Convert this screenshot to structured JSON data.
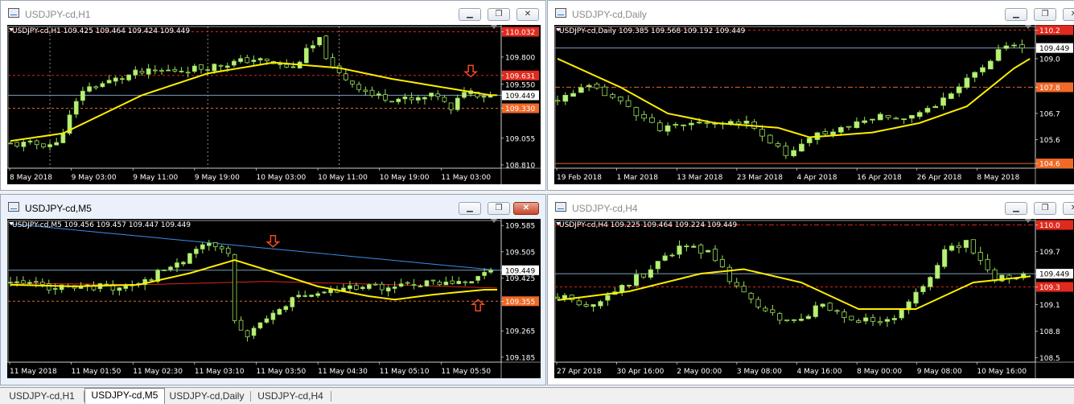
{
  "windows": [
    {
      "id": "h1",
      "title": "USDJPY-cd,H1",
      "symbol_line": "USDJPY-cd,H1  109.425 109.464 109.424 109.449",
      "active": false,
      "close_red": false,
      "chart": {
        "price_labels": [
          {
            "text": "110.032",
            "value": 110.032,
            "style": "red"
          },
          {
            "text": "109.800",
            "value": 109.8,
            "style": "plain"
          },
          {
            "text": "109.631",
            "value": 109.631,
            "style": "red"
          },
          {
            "text": "109.550",
            "value": 109.55,
            "style": "plain"
          },
          {
            "text": "109.449",
            "value": 109.449,
            "style": "white"
          },
          {
            "text": "109.330",
            "value": 109.33,
            "style": "orange"
          },
          {
            "text": "109.055",
            "value": 109.055,
            "style": "plain"
          },
          {
            "text": "108.810",
            "value": 108.81,
            "style": "plain"
          }
        ],
        "time_labels": [
          "8 May 2018",
          "9 May 03:00",
          "9 May 11:00",
          "9 May 19:00",
          "10 May 03:00",
          "10 May 11:00",
          "10 May 19:00",
          "11 May 03:00"
        ],
        "ymin": 108.78,
        "ymax": 110.08,
        "n": 74,
        "seed": 11,
        "start": 109.0,
        "end": 109.449,
        "shape": [
          [
            0,
            109.0
          ],
          [
            8,
            109.0
          ],
          [
            12,
            109.5
          ],
          [
            20,
            109.65
          ],
          [
            30,
            109.7
          ],
          [
            38,
            109.78
          ],
          [
            44,
            109.7
          ],
          [
            46,
            109.85
          ],
          [
            48,
            109.95
          ],
          [
            50,
            109.68
          ],
          [
            56,
            109.45
          ],
          [
            62,
            109.4
          ],
          [
            66,
            109.45
          ],
          [
            68,
            109.3
          ],
          [
            70,
            109.5
          ],
          [
            73,
            109.449
          ]
        ],
        "ma_shape": [
          [
            0,
            109.03
          ],
          [
            8,
            109.1
          ],
          [
            20,
            109.45
          ],
          [
            30,
            109.65
          ],
          [
            40,
            109.75
          ],
          [
            50,
            109.7
          ],
          [
            58,
            109.6
          ],
          [
            66,
            109.52
          ],
          [
            73,
            109.45
          ]
        ],
        "hlines": [
          {
            "value": 110.032,
            "color": "#d9261c",
            "dash": "3,3"
          },
          {
            "value": 109.631,
            "color": "#d9261c",
            "dash": "3,3"
          },
          {
            "value": 109.449,
            "color": "#7f9cb8",
            "dash": ""
          },
          {
            "value": 109.33,
            "color": "#e06a28",
            "dash": "3,3"
          }
        ],
        "vlines": [
          6,
          30,
          50
        ],
        "arrows": [
          {
            "kind": "down",
            "idx": 70,
            "value": 109.62
          }
        ]
      }
    },
    {
      "id": "daily",
      "title": "USDJPY-cd,Daily",
      "symbol_line": "USDJPY-cd,Daily  109.385 109.568 109.192 109.449",
      "active": false,
      "close_red": false,
      "chart": {
        "price_labels": [
          {
            "text": "110.2",
            "value": 110.2,
            "style": "red"
          },
          {
            "text": "109.449",
            "value": 109.449,
            "style": "white"
          },
          {
            "text": "109.0",
            "value": 109.0,
            "style": "plain"
          },
          {
            "text": "107.8",
            "value": 107.8,
            "style": "orange"
          },
          {
            "text": "106.7",
            "value": 106.7,
            "style": "plain"
          },
          {
            "text": "105.6",
            "value": 105.6,
            "style": "plain"
          },
          {
            "text": "104.6",
            "value": 104.6,
            "style": "orange"
          }
        ],
        "time_labels": [
          "19 Feb 2018",
          "1 Mar 2018",
          "13 Mar 2018",
          "23 Mar 2018",
          "4 Apr 2018",
          "16 Apr 2018",
          "26 Apr 2018",
          "8 May 2018"
        ],
        "ymin": 104.4,
        "ymax": 110.35,
        "n": 60,
        "seed": 23,
        "start": 107.2,
        "end": 109.449,
        "shape": [
          [
            0,
            107.2
          ],
          [
            5,
            107.8
          ],
          [
            10,
            107.0
          ],
          [
            14,
            106.0
          ],
          [
            20,
            106.4
          ],
          [
            26,
            106.2
          ],
          [
            30,
            104.9
          ],
          [
            34,
            105.8
          ],
          [
            38,
            106.2
          ],
          [
            42,
            106.6
          ],
          [
            46,
            106.6
          ],
          [
            50,
            107.3
          ],
          [
            54,
            108.4
          ],
          [
            58,
            109.6
          ],
          [
            60,
            109.449
          ]
        ],
        "ma_shape": [
          [
            0,
            109.0
          ],
          [
            8,
            107.8
          ],
          [
            14,
            106.7
          ],
          [
            20,
            106.3
          ],
          [
            28,
            106.1
          ],
          [
            32,
            105.7
          ],
          [
            40,
            105.9
          ],
          [
            46,
            106.3
          ],
          [
            52,
            107.0
          ],
          [
            58,
            108.6
          ],
          [
            60,
            109.0
          ]
        ],
        "hlines": [
          {
            "value": 110.2,
            "color": "#d9261c",
            "dash": "3,3"
          },
          {
            "value": 109.449,
            "color": "#7f9cb8",
            "dash": ""
          },
          {
            "value": 107.8,
            "color": "#e06a28",
            "dash": "6,3,2,3"
          },
          {
            "value": 104.6,
            "color": "#e06a28",
            "dash": ""
          }
        ],
        "vlines": [],
        "arrows": []
      }
    },
    {
      "id": "m5",
      "title": "USDJPY-cd,M5",
      "symbol_line": "USDJPY-cd,M5  109.456 109.457 109.447 109.449",
      "active": true,
      "close_red": true,
      "chart": {
        "price_labels": [
          {
            "text": "109.585",
            "value": 109.585,
            "style": "plain"
          },
          {
            "text": "109.505",
            "value": 109.505,
            "style": "plain"
          },
          {
            "text": "109.449",
            "value": 109.449,
            "style": "white"
          },
          {
            "text": "109.425",
            "value": 109.425,
            "style": "plain"
          },
          {
            "text": "109.355",
            "value": 109.355,
            "style": "orange"
          },
          {
            "text": "109.265",
            "value": 109.265,
            "style": "plain"
          },
          {
            "text": "109.185",
            "value": 109.185,
            "style": "plain"
          }
        ],
        "time_labels": [
          "11 May 2018",
          "11 May 01:50",
          "11 May 02:30",
          "11 May 03:10",
          "11 May 03:50",
          "11 May 04:30",
          "11 May 05:10",
          "11 May 05:50"
        ],
        "ymin": 109.17,
        "ymax": 109.6,
        "n": 76,
        "seed": 37,
        "start": 109.41,
        "end": 109.449,
        "shape": [
          [
            0,
            109.41
          ],
          [
            10,
            109.395
          ],
          [
            20,
            109.4
          ],
          [
            26,
            109.46
          ],
          [
            32,
            109.53
          ],
          [
            35,
            109.5
          ],
          [
            36,
            109.3
          ],
          [
            38,
            109.25
          ],
          [
            45,
            109.36
          ],
          [
            52,
            109.39
          ],
          [
            60,
            109.4
          ],
          [
            68,
            109.41
          ],
          [
            73,
            109.42
          ],
          [
            76,
            109.449
          ]
        ],
        "ma_shape": [
          [
            0,
            109.405
          ],
          [
            10,
            109.4
          ],
          [
            20,
            109.405
          ],
          [
            28,
            109.44
          ],
          [
            35,
            109.48
          ],
          [
            40,
            109.45
          ],
          [
            48,
            109.4
          ],
          [
            56,
            109.37
          ],
          [
            60,
            109.36
          ],
          [
            66,
            109.375
          ],
          [
            74,
            109.39
          ]
        ],
        "extra_lines": [
          {
            "color": "#3a8ee6",
            "pts": [
              [
                0,
                109.59
              ],
              [
                76,
                109.449
              ]
            ]
          },
          {
            "color": "#d9261c",
            "pts": [
              [
                0,
                109.41
              ],
              [
                20,
                109.405
              ],
              [
                40,
                109.415
              ],
              [
                60,
                109.405
              ],
              [
                76,
                109.395
              ]
            ]
          }
        ],
        "hlines": [
          {
            "value": 109.449,
            "color": "#7f9cb8",
            "dash": ""
          },
          {
            "value": 109.355,
            "color": "#e06a28",
            "dash": "3,3"
          }
        ],
        "vlines": [],
        "arrows": [
          {
            "kind": "down",
            "idx": 41,
            "value": 109.52
          },
          {
            "kind": "up",
            "idx": 73,
            "value": 109.36
          }
        ]
      }
    },
    {
      "id": "h4",
      "title": "USDJPY-cd,H4",
      "symbol_line": "USDJPY-cd,H4  109.225 109.464 109.224 109.449",
      "active": false,
      "close_red": false,
      "chart": {
        "price_labels": [
          {
            "text": "110.0",
            "value": 110.0,
            "style": "red"
          },
          {
            "text": "109.7",
            "value": 109.7,
            "style": "plain"
          },
          {
            "text": "109.449",
            "value": 109.449,
            "style": "white"
          },
          {
            "text": "109.3",
            "value": 109.3,
            "style": "red"
          },
          {
            "text": "109.1",
            "value": 109.1,
            "style": "plain"
          },
          {
            "text": "108.8",
            "value": 108.8,
            "style": "plain"
          },
          {
            "text": "108.5",
            "value": 108.5,
            "style": "plain"
          }
        ],
        "time_labels": [
          "27 Apr 2018",
          "30 Apr 16:00",
          "2 May 00:00",
          "3 May 08:00",
          "4 May 16:00",
          "8 May 00:00",
          "9 May 08:00",
          "10 May 16:00"
        ],
        "ymin": 108.45,
        "ymax": 110.05,
        "n": 66,
        "seed": 53,
        "start": 109.2,
        "end": 109.449,
        "shape": [
          [
            0,
            109.2
          ],
          [
            6,
            109.1
          ],
          [
            10,
            109.3
          ],
          [
            14,
            109.5
          ],
          [
            18,
            109.75
          ],
          [
            22,
            109.7
          ],
          [
            25,
            109.4
          ],
          [
            30,
            109.0
          ],
          [
            34,
            108.9
          ],
          [
            38,
            109.1
          ],
          [
            42,
            108.9
          ],
          [
            48,
            108.95
          ],
          [
            52,
            109.3
          ],
          [
            55,
            109.7
          ],
          [
            58,
            109.8
          ],
          [
            62,
            109.4
          ],
          [
            66,
            109.449
          ]
        ],
        "ma_shape": [
          [
            0,
            109.15
          ],
          [
            10,
            109.25
          ],
          [
            20,
            109.45
          ],
          [
            26,
            109.5
          ],
          [
            34,
            109.35
          ],
          [
            42,
            109.05
          ],
          [
            50,
            109.05
          ],
          [
            58,
            109.35
          ],
          [
            66,
            109.42
          ]
        ],
        "hlines": [
          {
            "value": 110.0,
            "color": "#d9261c",
            "dash": "6,3,2,3"
          },
          {
            "value": 109.449,
            "color": "#7f9cb8",
            "dash": ""
          },
          {
            "value": 109.3,
            "color": "#d9261c",
            "dash": "3,3"
          }
        ],
        "vlines": [],
        "arrows": []
      }
    }
  ],
  "tabs": [
    "USDJPY-cd,H1",
    "USDJPY-cd,M5",
    "USDJPY-cd,Daily",
    "USDJPY-cd,H4"
  ],
  "selected_tab": 1,
  "colors": {
    "bull": "#b8f07a",
    "bear": "#000000",
    "wick": "#9be05a",
    "ma": "#ffee00",
    "axis_text": "#ffffff",
    "red_label": "#e02a1e",
    "orange_label": "#f06a28"
  }
}
